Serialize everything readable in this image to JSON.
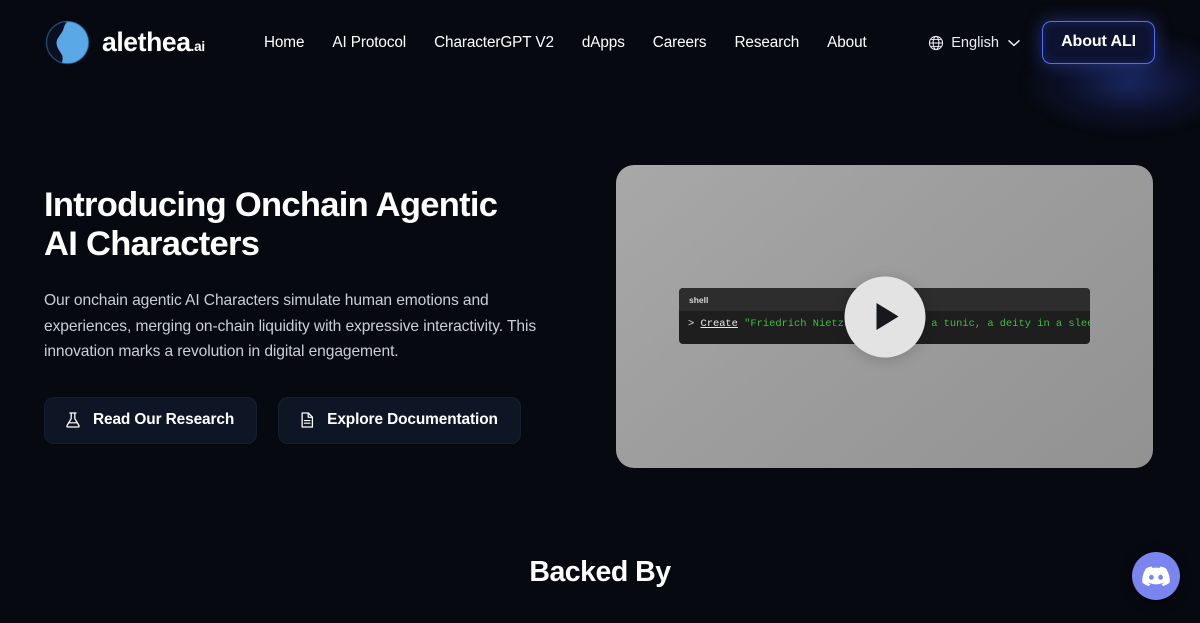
{
  "brand": {
    "name": "alethea",
    "suffix": ".ai",
    "logo_icon": "alethea-face-circle-logo",
    "accent_color": "#5aa9e6"
  },
  "nav": {
    "items": [
      {
        "label": "Home"
      },
      {
        "label": "AI Protocol"
      },
      {
        "label": "CharacterGPT V2"
      },
      {
        "label": "dApps"
      },
      {
        "label": "Careers"
      },
      {
        "label": "Research"
      },
      {
        "label": "About"
      }
    ],
    "language": {
      "label": "English",
      "globe_icon": "globe-icon",
      "chevron_icon": "chevron-down-icon"
    },
    "cta": {
      "label": "About ALI",
      "border_color": "#4f6ef5",
      "background_color": "#0d1330"
    }
  },
  "hero": {
    "title": "Introducing Onchain Agentic AI Characters",
    "subtitle": "Our onchain agentic AI Characters simulate human emotions and experiences, merging on-chain liquidity with expressive interactivity. This innovation marks a revolution in digital engagement.",
    "buttons": [
      {
        "label": "Read Our Research",
        "icon": "flask-icon"
      },
      {
        "label": "Explore Documentation",
        "icon": "document-icon"
      }
    ]
  },
  "video": {
    "play_icon": "play-icon",
    "terminal": {
      "tab_label": "shell",
      "prompt": "> ",
      "command": "Create",
      "argument": " \"Friedrich Nietzsche, wearing a tunic, a deity in a sleeping pose\"",
      "command_color": "#e8e8e8",
      "string_color": "#3fbf3f"
    }
  },
  "sections": {
    "backed_by_title": "Backed By"
  },
  "widgets": {
    "discord": {
      "icon": "discord-icon",
      "background_color": "#7a85ef"
    }
  }
}
